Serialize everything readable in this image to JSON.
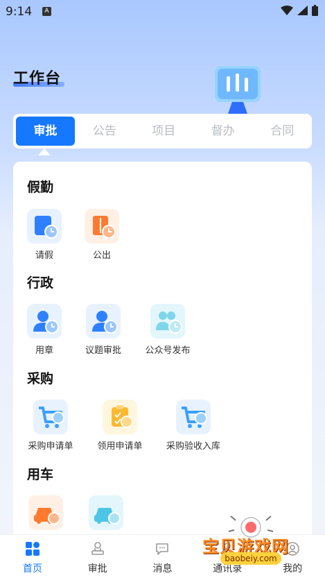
{
  "status_bar": {
    "time": "9:14",
    "app_letter": "A"
  },
  "page": {
    "title": "工作台"
  },
  "tabs": [
    {
      "label": "审批",
      "active": true
    },
    {
      "label": "公告",
      "active": false
    },
    {
      "label": "项目",
      "active": false
    },
    {
      "label": "督办",
      "active": false
    },
    {
      "label": "合同",
      "active": false
    }
  ],
  "sections": [
    {
      "title": "假勤",
      "items": [
        {
          "label": "请假",
          "icon": "leave-icon"
        },
        {
          "label": "公出",
          "icon": "business-trip-icon"
        }
      ]
    },
    {
      "title": "行政",
      "items": [
        {
          "label": "用章",
          "icon": "seal-icon"
        },
        {
          "label": "议题审批",
          "icon": "topic-approval-icon"
        },
        {
          "label": "公众号发布",
          "icon": "account-publish-icon"
        }
      ]
    },
    {
      "title": "采购",
      "items": [
        {
          "label": "采购申请单",
          "icon": "purchase-request-icon"
        },
        {
          "label": "领用申请单",
          "icon": "requisition-icon"
        },
        {
          "label": "采购验收入库",
          "icon": "purchase-acceptance-icon"
        }
      ]
    },
    {
      "title": "用车",
      "items": [
        {
          "label": "",
          "icon": "car-request-icon"
        },
        {
          "label": "",
          "icon": "car-return-icon"
        }
      ]
    }
  ],
  "bottom_nav": [
    {
      "label": "首页",
      "icon": "home-icon",
      "active": true
    },
    {
      "label": "审批",
      "icon": "approval-icon",
      "active": false
    },
    {
      "label": "消息",
      "icon": "message-icon",
      "active": false
    },
    {
      "label": "通讯录",
      "icon": "contacts-icon",
      "active": false
    },
    {
      "label": "我的",
      "icon": "profile-icon",
      "active": false
    }
  ],
  "watermark": {
    "text": "宝贝游戏网",
    "url": "baobeiy.com"
  },
  "colors": {
    "accent": "#1677ff",
    "orange": "#ff7a2f",
    "teal": "#4cc6e6",
    "yellow": "#ffb82e"
  }
}
